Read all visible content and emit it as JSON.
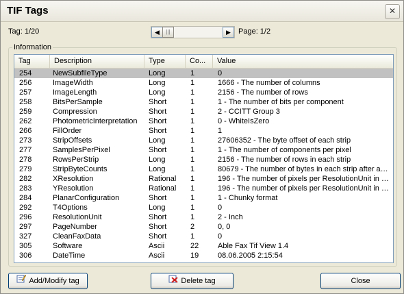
{
  "window": {
    "title": "TIF Tags",
    "close_glyph": "✕"
  },
  "toolbar": {
    "tag_counter": "Tag: 1/20",
    "page_counter": "Page: 1/2",
    "scroll_left": "◀",
    "scroll_right": "▶",
    "scroll_thumb": "|||"
  },
  "group": {
    "label": "Information"
  },
  "table": {
    "columns": [
      "Tag",
      "Description",
      "Type",
      "Co...",
      "Value"
    ],
    "rows": [
      [
        "254",
        "NewSubfileType",
        "Long",
        "1",
        "0"
      ],
      [
        "256",
        "ImageWidth",
        "Long",
        "1",
        "1666 - The number of columns"
      ],
      [
        "257",
        "ImageLength",
        "Long",
        "1",
        "2156 - The number of rows"
      ],
      [
        "258",
        "BitsPerSample",
        "Short",
        "1",
        "1 - The number of bits per component"
      ],
      [
        "259",
        "Compression",
        "Short",
        "1",
        "2 - CCITT Group 3"
      ],
      [
        "262",
        "PhotometricInterpretation",
        "Short",
        "1",
        "0 - WhiteIsZero"
      ],
      [
        "266",
        "FillOrder",
        "Short",
        "1",
        "1"
      ],
      [
        "273",
        "StripOffsets",
        "Long",
        "1",
        "27606352 - The byte offset of each strip"
      ],
      [
        "277",
        "SamplesPerPixel",
        "Short",
        "1",
        "1 - The number of components per pixel"
      ],
      [
        "278",
        "RowsPerStrip",
        "Long",
        "1",
        "2156 - The number of rows in each strip"
      ],
      [
        "279",
        "StripByteCounts",
        "Long",
        "1",
        "80679 - The number of bytes in each strip after an..."
      ],
      [
        "282",
        "XResolution",
        "Rational",
        "1",
        "196 - The number of pixels per ResolutionUnit in th..."
      ],
      [
        "283",
        "YResolution",
        "Rational",
        "1",
        "196 - The number of pixels per ResolutionUnit in th..."
      ],
      [
        "284",
        "PlanarConfiguration",
        "Short",
        "1",
        "1 - Chunky format"
      ],
      [
        "292",
        "T4Options",
        "Long",
        "1",
        "0"
      ],
      [
        "296",
        "ResolutionUnit",
        "Short",
        "1",
        "2 - Inch"
      ],
      [
        "297",
        "PageNumber",
        "Short",
        "2",
        "0, 0"
      ],
      [
        "327",
        "CleanFaxData",
        "Short",
        "1",
        "0"
      ],
      [
        "305",
        "Software",
        "Ascii",
        "22",
        "Able Fax Tif View 1.4"
      ],
      [
        "306",
        "DateTime",
        "Ascii",
        "19",
        "08.06.2005 2:15:54"
      ]
    ],
    "selected_row": 0
  },
  "buttons": {
    "add": "Add/Modify tag",
    "delete": "Delete tag",
    "close": "Close"
  },
  "icons": {
    "add": "edit-icon",
    "delete": "delete-icon"
  }
}
